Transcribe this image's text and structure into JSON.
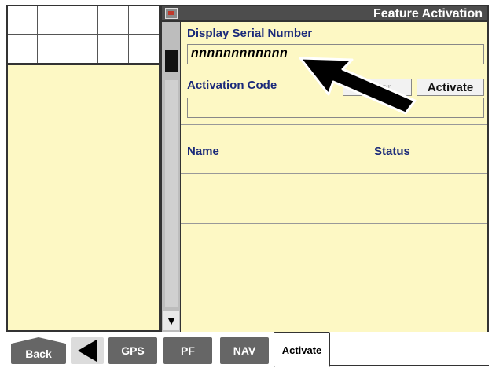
{
  "header": {
    "title": "Feature Activation",
    "icon": "display-icon"
  },
  "form": {
    "serial_label": "Display Serial Number",
    "serial_value": "nnnnnnnnnnnn",
    "activation_label": "Activation Code",
    "activation_value": "",
    "enter_button": "Enter",
    "activate_button": "Activate"
  },
  "table": {
    "columns": [
      "Name",
      "Status"
    ],
    "rows": []
  },
  "tabs": [
    {
      "label": "Back"
    },
    {
      "label": "",
      "icon": "left-arrow-icon"
    },
    {
      "label": "GPS"
    },
    {
      "label": "PF"
    },
    {
      "label": "NAV"
    },
    {
      "label": "Activate",
      "active": true
    }
  ],
  "colors": {
    "panel_bg": "#fdf8c4",
    "header_bg": "#4d4d4d",
    "label_color": "#1b2a7a",
    "tab_bg": "#666666"
  }
}
